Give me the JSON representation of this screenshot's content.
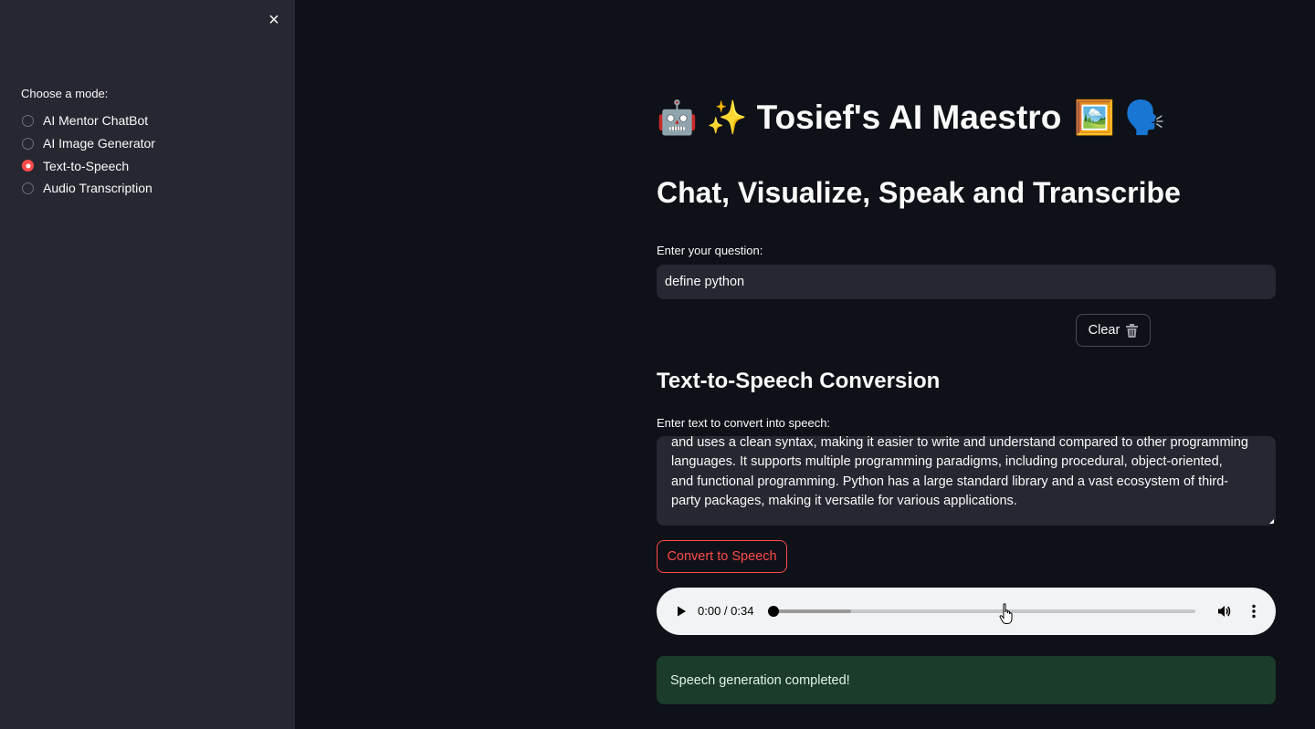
{
  "sidebar": {
    "close_icon": "×",
    "mode_label": "Choose a mode:",
    "modes": [
      "AI Mentor ChatBot",
      "AI Image Generator",
      "Text-to-Speech",
      "Audio Transcription"
    ],
    "selected_mode": "Text-to-Speech"
  },
  "header": {
    "emojis_left": [
      "🤖",
      "✨"
    ],
    "title": "Tosief's AI Maestro",
    "emojis_right": [
      "🖼️",
      "🗣️"
    ],
    "subtitle": "Chat, Visualize, Speak and Transcribe"
  },
  "question": {
    "label": "Enter your question:",
    "value": "define python"
  },
  "clear_button": {
    "label": "Clear",
    "icon": "trash-icon"
  },
  "tts": {
    "section_title": "Text-to-Speech Conversion",
    "label": "Enter text to convert into speech:",
    "text": "and uses a clean syntax, making it easier to write and understand compared to other programming\nlanguages. It supports multiple programming paradigms, including procedural, object-oriented,\nand functional programming. Python has a large standard library and a vast ecosystem of third-\nparty packages, making it versatile for various applications.",
    "button_label": "Convert to Speech"
  },
  "audio": {
    "time": "0:00 / 0:34",
    "progress": 0
  },
  "status": {
    "message": "Speech generation completed!"
  },
  "colors": {
    "accent": "#ff4b4b",
    "background": "#0e1117",
    "sidebar": "#262730",
    "success_bg": "#1b3b2b"
  }
}
